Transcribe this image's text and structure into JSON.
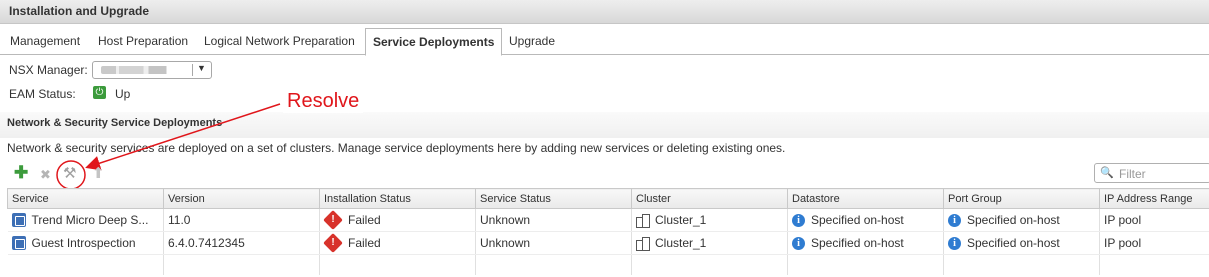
{
  "window": {
    "title": "Installation and Upgrade"
  },
  "tabs": [
    {
      "label": "Management"
    },
    {
      "label": "Host Preparation"
    },
    {
      "label": "Logical Network Preparation"
    },
    {
      "label": "Service Deployments",
      "active": true
    },
    {
      "label": "Upgrade"
    }
  ],
  "nsx": {
    "label": "NSX Manager:"
  },
  "eam": {
    "label": "EAM Status:",
    "value": "Up"
  },
  "section": {
    "title": "Network & Security Service Deployments",
    "description": "Network & security services are deployed on a set of clusters. Manage service deployments here by adding new services or deleting existing ones."
  },
  "toolbar": {
    "icons": [
      "add-icon",
      "delete-icon",
      "resolve-icon",
      "upgrade-icon"
    ],
    "filter_placeholder": "Filter"
  },
  "annotation": {
    "label": "Resolve",
    "color": "#e0161b"
  },
  "table": {
    "columns": [
      "Service",
      "Version",
      "Installation Status",
      "Service Status",
      "Cluster",
      "Datastore",
      "Port Group",
      "IP Address Range"
    ],
    "rows": [
      {
        "service": "Trend Micro Deep S...",
        "version": "11.0",
        "installation_status": "Failed",
        "service_status": "Unknown",
        "cluster": "Cluster_1",
        "datastore": "Specified on-host",
        "port_group": "Specified on-host",
        "ip_range": "IP pool"
      },
      {
        "service": "Guest Introspection",
        "version": "6.4.0.7412345",
        "installation_status": "Failed",
        "service_status": "Unknown",
        "cluster": "Cluster_1",
        "datastore": "Specified on-host",
        "port_group": "Specified on-host",
        "ip_range": "IP pool"
      }
    ]
  },
  "colors": {
    "failed": "#d8322b",
    "info": "#2f7cd1",
    "add": "#3c9b3c",
    "annotation": "#e0161b"
  }
}
